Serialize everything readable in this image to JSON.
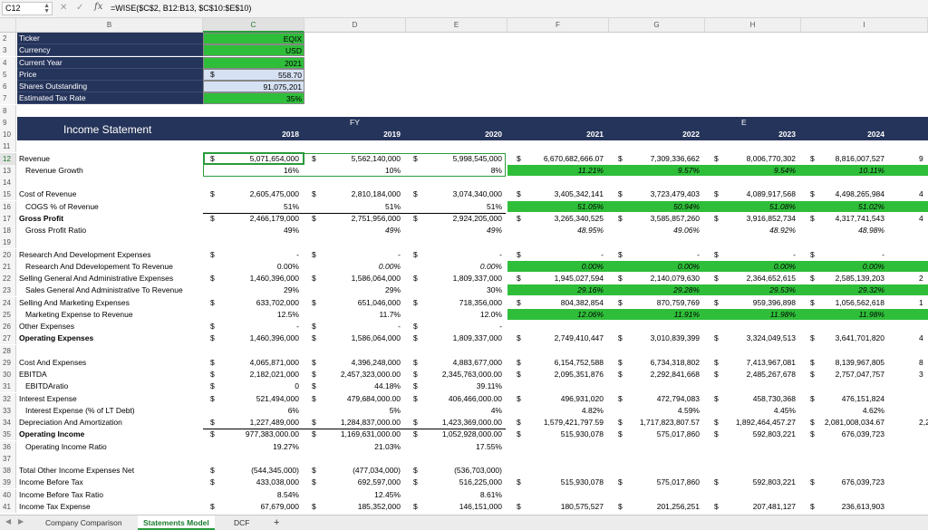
{
  "formula_bar": {
    "name_box": "C12",
    "formula": "=WISE($C$2, B12:B13, $C$10:$E$10)"
  },
  "columns": [
    "B",
    "C",
    "D",
    "E",
    "F",
    "G",
    "H",
    "I"
  ],
  "inputs": {
    "ticker_label": "Ticker",
    "ticker": "EQIX",
    "currency_label": "Currency",
    "currency": "USD",
    "year_label": "Current Year",
    "year": "2021",
    "price_label": "Price",
    "price_sym": "$",
    "price": "558.70",
    "shares_label": "Shares Outstanding",
    "shares": "91,075,201",
    "tax_label": "Estimated Tax Rate",
    "tax": "35%"
  },
  "header": {
    "title": "Income Statement",
    "fy": "FY",
    "e": "E",
    "years": [
      "2018",
      "2019",
      "2020",
      "2021",
      "2022",
      "2023",
      "2024"
    ]
  },
  "rows": [
    {
      "n": "12",
      "label": "Revenue",
      "sym": "$",
      "v": [
        "5,071,654,000",
        "5,562,140,000",
        "5,998,545,000",
        "6,670,682,666.07",
        "7,309,336,662",
        "8,006,770,302",
        "8,816,007,527"
      ]
    },
    {
      "n": "13",
      "label": "Revenue Growth",
      "ind": true,
      "v": [
        "16%",
        "10%",
        "8%",
        "11.21%",
        "9.57%",
        "9.54%",
        "10.11%"
      ]
    },
    {
      "n": "15",
      "label": "Cost of Revenue",
      "sym": "$",
      "v": [
        "2,605,475,000",
        "2,810,184,000",
        "3,074,340,000",
        "3,405,342,141",
        "3,723,479,403",
        "4,089,917,568",
        "4,498,265,984"
      ]
    },
    {
      "n": "16",
      "label": "COGS % of Revenue",
      "ind": true,
      "v": [
        "51%",
        "51%",
        "51%",
        "51.05%",
        "50.94%",
        "51.08%",
        "51.02%"
      ]
    },
    {
      "n": "17",
      "label": "Gross Profit",
      "bold": true,
      "sym": "$",
      "v": [
        "2,466,179,000",
        "2,751,956,000",
        "2,924,205,000",
        "3,265,340,525",
        "3,585,857,260",
        "3,916,852,734",
        "4,317,741,543"
      ]
    },
    {
      "n": "18",
      "label": "Gross Profit Ratio",
      "ind": true,
      "v": [
        "49%",
        "49%",
        "49%",
        "48.95%",
        "49.06%",
        "48.92%",
        "48.98%"
      ]
    },
    {
      "n": "20",
      "label": "Research And Development Expenses",
      "sym": "$",
      "v": [
        "-",
        "-",
        "-",
        "-",
        "-",
        "-",
        "-"
      ]
    },
    {
      "n": "21",
      "label": "Research And Ddevelopement To Revenue",
      "ind": true,
      "v": [
        "0.00%",
        "0.00%",
        "0.00%",
        "0.00%",
        "0.00%",
        "0.00%",
        "0.00%"
      ]
    },
    {
      "n": "22",
      "label": "Selling General And Administrative Expenses",
      "sym": "$",
      "v": [
        "1,460,396,000",
        "1,586,064,000",
        "1,809,337,000",
        "1,945,027,594",
        "2,140,079,630",
        "2,364,652,615",
        "2,585,139,203"
      ]
    },
    {
      "n": "23",
      "label": "Sales General And Administrative To Revenue",
      "ind": true,
      "v": [
        "29%",
        "29%",
        "30%",
        "29.16%",
        "29.28%",
        "29.53%",
        "29.32%"
      ]
    },
    {
      "n": "24",
      "label": "Selling And Marketing Expenses",
      "sym": "$",
      "v": [
        "633,702,000",
        "651,046,000",
        "718,356,000",
        "804,382,854",
        "870,759,769",
        "959,396,898",
        "1,056,562,618"
      ]
    },
    {
      "n": "25",
      "label": "Marketing Expense to Revenue",
      "ind": true,
      "v": [
        "12.5%",
        "11.7%",
        "12.0%",
        "12.06%",
        "11.91%",
        "11.98%",
        "11.98%"
      ]
    },
    {
      "n": "26",
      "label": "Other Expenses",
      "sym": "$",
      "v": [
        "-",
        "-",
        "-",
        "",
        "",
        "",
        ""
      ]
    },
    {
      "n": "27",
      "label": "Operating Expenses",
      "bold": true,
      "sym": "$",
      "v": [
        "1,460,396,000",
        "1,586,064,000",
        "1,809,337,000",
        "2,749,410,447",
        "3,010,839,399",
        "3,324,049,513",
        "3,641,701,820"
      ]
    },
    {
      "n": "29",
      "label": "Cost And Expenses",
      "sym": "$",
      "v": [
        "4,065,871,000",
        "4,396,248,000",
        "4,883,677,000",
        "6,154,752,588",
        "6,734,318,802",
        "7,413,967,081",
        "8,139,967,805"
      ]
    },
    {
      "n": "30",
      "label": "EBITDA",
      "sym": "$",
      "v": [
        "2,182,021,000",
        "2,457,323,000.00",
        "2,345,763,000.00",
        "2,095,351,876",
        "2,292,841,668",
        "2,485,267,678",
        "2,757,047,757"
      ]
    },
    {
      "n": "31",
      "label": "EBITDAratio",
      "ind": true,
      "sym": "$",
      "v": [
        "0",
        "44.18%",
        "39.11%",
        "",
        "",
        "",
        ""
      ]
    },
    {
      "n": "32",
      "label": "Interest Expense",
      "sym": "$",
      "v": [
        "521,494,000",
        "479,684,000.00",
        "406,466,000.00",
        "496,931,020",
        "472,794,083",
        "458,730,368",
        "476,151,824"
      ]
    },
    {
      "n": "33",
      "label": "Interest Expense (% of LT Debt)",
      "ind": true,
      "v": [
        "6%",
        "5%",
        "4%",
        "4.82%",
        "4.59%",
        "4.45%",
        "4.62%"
      ]
    },
    {
      "n": "34",
      "label": "Depreciation And Amortization",
      "sym": "$",
      "v": [
        "1,227,489,000",
        "1,284,837,000.00",
        "1,423,369,000.00",
        "1,579,421,797.59",
        "1,717,823,807.57",
        "1,892,464,457.27",
        "2,081,008,034.67"
      ]
    },
    {
      "n": "35",
      "label": "Operating Income",
      "bold": true,
      "sym": "$",
      "v": [
        "977,383,000.00",
        "1,169,631,000.00",
        "1,052,928,000.00",
        "515,930,078",
        "575,017,860",
        "592,803,221",
        "676,039,723"
      ]
    },
    {
      "n": "36",
      "label": "Operating Income Ratio",
      "ind": true,
      "v": [
        "19.27%",
        "21.03%",
        "17.55%",
        "",
        "",
        "",
        ""
      ]
    },
    {
      "n": "38",
      "label": "Total Other Income Expenses Net",
      "sym": "$",
      "v": [
        "(544,345,000)",
        "(477,034,000)",
        "(536,703,000)",
        "",
        "",
        "",
        ""
      ]
    },
    {
      "n": "39",
      "label": "Income Before Tax",
      "sym": "$",
      "v": [
        "433,038,000",
        "692,597,000",
        "516,225,000",
        "515,930,078",
        "575,017,860",
        "592,803,221",
        "676,039,723"
      ]
    },
    {
      "n": "40",
      "label": "Income Before Tax Ratio",
      "v": [
        "8.54%",
        "12.45%",
        "8.61%",
        "",
        "",
        "",
        ""
      ]
    },
    {
      "n": "41",
      "label": "Income Tax Expense",
      "sym": "$",
      "v": [
        "67,679,000",
        "185,352,000",
        "146,151,000",
        "180,575,527",
        "201,256,251",
        "207,481,127",
        "236,613,903"
      ]
    }
  ],
  "edge_values": {
    "12": "9",
    "15": "4",
    "17": "4",
    "22": "2",
    "24": "1",
    "27": "4",
    "29": "8",
    "30": "3",
    "34": "2,28"
  },
  "tabs": [
    "Company Comparison",
    "Statements Model",
    "DCF"
  ],
  "tab_add": "+",
  "colors": {
    "navy": "#25345a",
    "green": "#2fbe3a",
    "excel_green": "#2a9b3c"
  }
}
